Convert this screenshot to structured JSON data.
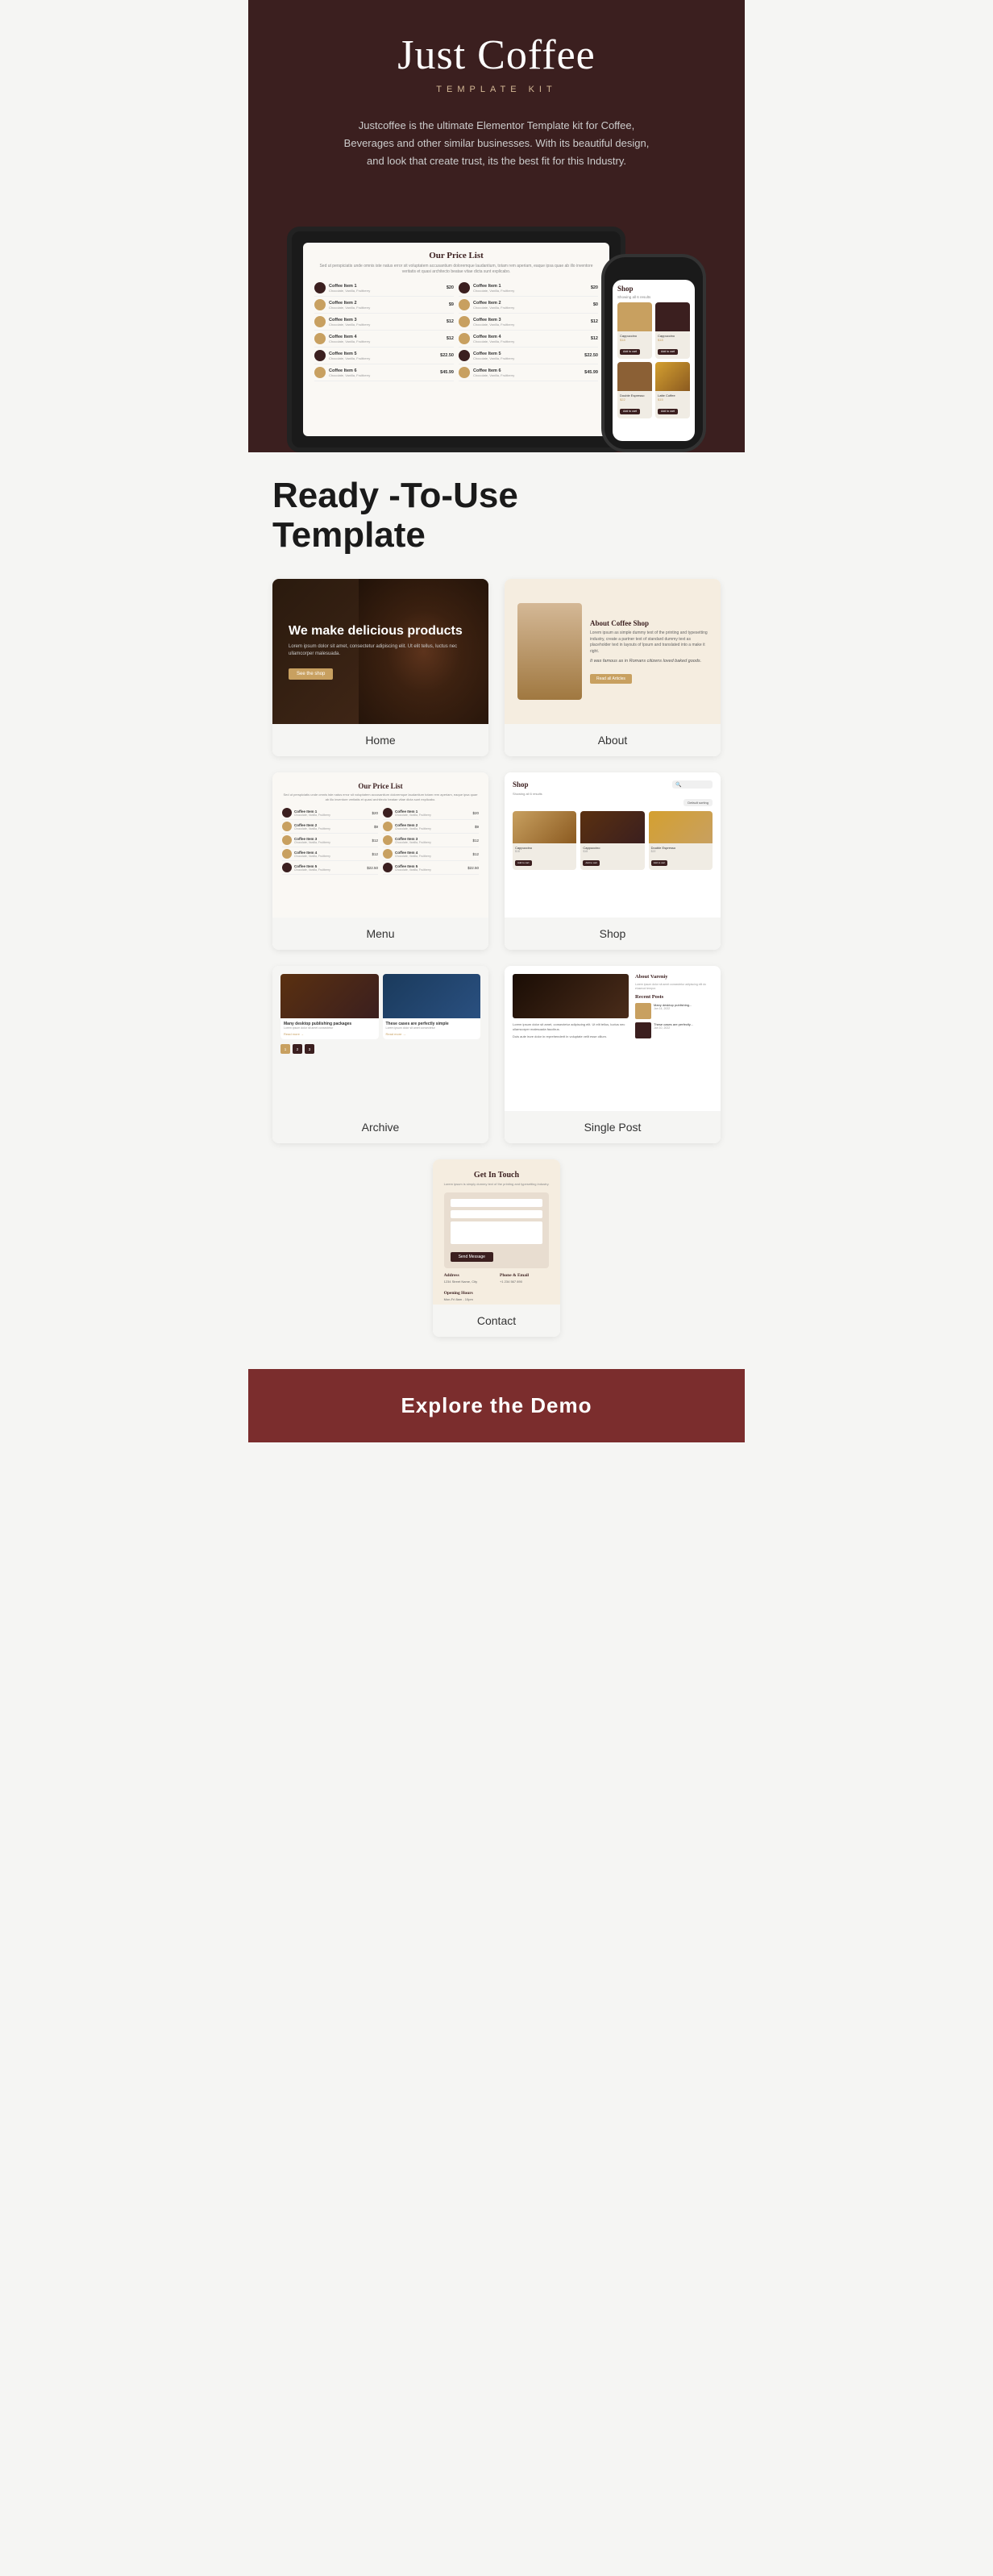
{
  "header": {
    "title": "Just Coffee",
    "subtitle": "TEMPLATE KIT",
    "description": "Justcoffee is the ultimate Elementor Template kit for Coffee, Beverages and other similar businesses. With its beautiful design, and look that create trust, its the best fit for this Industry."
  },
  "tablet": {
    "section_title": "Our Price List",
    "description": "Sed ut perspiciatis unde omnis iste natus error sit voluptatem accusantium doloremque laudantium, totam rem aperiam, eaque ipsa quae ab illo inventore veritatis et quasi architecto beatae vitae dicta sunt explicabo.",
    "items": [
      {
        "name": "Coffee Item 1",
        "desc": "Chocolate, Vanilla, Fruitberry",
        "price": "$20",
        "icon": "dark"
      },
      {
        "name": "Coffee Item 2",
        "desc": "Chocolate, Vanilla, Fruitberry",
        "price": "$9",
        "icon": "golden"
      },
      {
        "name": "Coffee Item 3",
        "desc": "Chocolate, Vanilla, Fruitberry",
        "price": "$12",
        "icon": "golden"
      },
      {
        "name": "Coffee Item 4",
        "desc": "Chocolate, Vanilla, Fruitberry",
        "price": "$12",
        "icon": "golden"
      },
      {
        "name": "Coffee Item 5",
        "desc": "Chocolate, Vanilla, Fruitberry",
        "price": "$22.50",
        "icon": "dark"
      },
      {
        "name": "Coffee Item 6",
        "desc": "Chocolate, Vanilla, Fruitberry",
        "price": "$45.99",
        "icon": "golden"
      }
    ]
  },
  "phone": {
    "title": "Shop",
    "subtitle": "Showing all 6 results",
    "products": [
      {
        "name": "Cappuccino",
        "price": "$18",
        "style": "warm"
      },
      {
        "name": "Cappuccino",
        "price": "$18",
        "style": "dark"
      },
      {
        "name": "Double Espresso",
        "price": "$22",
        "style": "medium"
      },
      {
        "name": "Latte Coffee",
        "price": "$15",
        "style": "golden"
      }
    ]
  },
  "ready_section": {
    "title": "Ready -To-Use\nTemplate"
  },
  "templates": {
    "home": {
      "label": "Home",
      "headline": "We make delicious products",
      "description": "Lorem ipsum dolor sit amet, consectetur adipiscing elit. Ut elit tellus, luctus nec ullamcorper malesuada.",
      "button": "See the shop"
    },
    "about": {
      "label": "About",
      "title": "About Coffee Shop",
      "description": "Lorem ipsum as simple dummy text of the printing and typesetting industry, create a partner text of standard dummy text as placeholder text in layouts of Ipsum and translated into a make it right.",
      "italic": "It was famous as in Romans citizens loved baked goods.",
      "button": "Read all Articles"
    },
    "menu": {
      "label": "Menu",
      "title": "Our Price List"
    },
    "shop": {
      "label": "Shop",
      "title": "Shop",
      "subtitle": "Showing all 6 results",
      "filter": "Default sorting",
      "products": [
        {
          "name": "Cappuccino",
          "price": "$18",
          "style": "warm"
        },
        {
          "name": "Cappuccino",
          "price": "$18",
          "style": "dark"
        },
        {
          "name": "Double Espresso",
          "price": "$22",
          "style": "golden"
        }
      ]
    },
    "archive": {
      "label": "Archive",
      "posts": [
        {
          "title": "Many desktop publishing packages",
          "style": "coffee"
        },
        {
          "title": "These cases are perfectly simple",
          "style": "blue"
        }
      ]
    },
    "single_post": {
      "label": "Single Post",
      "sidebar_title": "About Vareniy",
      "recent_posts_title": "Recent Posts"
    },
    "contact": {
      "label": "Contact",
      "title": "Get In Touch",
      "description": "Lorem ipsum is simply dummy text of the printing and typesetting industry.",
      "fields": {
        "address_title": "Address",
        "address_value": "1234 Street Name, City",
        "phone_title": "Phone & Email",
        "phone_value": "+1 234 567 890",
        "hours_title": "Opening Hours",
        "hours_value": "Mon-Fri 8am - 10pm"
      },
      "button": "Send Message"
    }
  },
  "explore": {
    "label": "Explore the Demo"
  }
}
